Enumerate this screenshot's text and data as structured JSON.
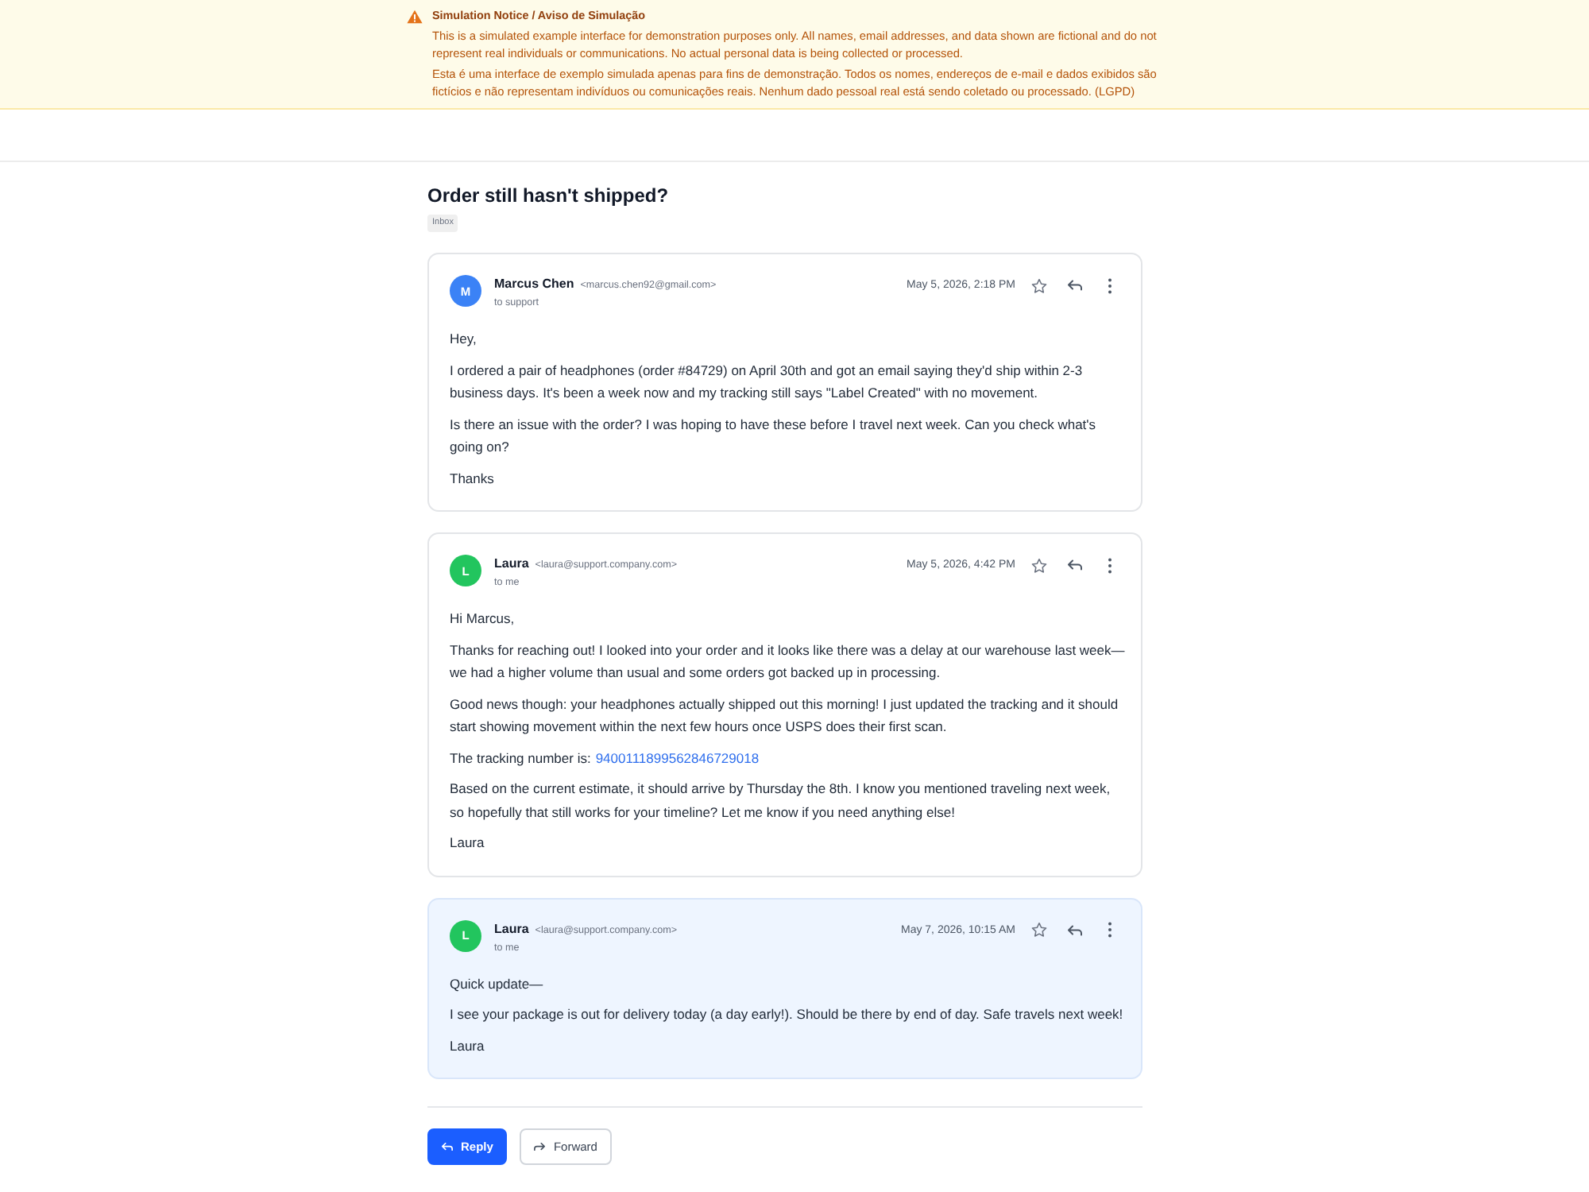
{
  "notice": {
    "title": "Simulation Notice / Aviso de Simulação",
    "paragraphs": [
      "This is a simulated example interface for demonstration purposes only. All names, email addresses, and data shown are fictional and do not represent real individuals or communications. No actual personal data is being collected or processed.",
      "Esta é uma interface de exemplo simulada apenas para fins de demonstração. Todos os nomes, endereços de e-mail e dados exibidos são fictícios e não representam indivíduos ou comunicações reais. Nenhum dado pessoal real está sendo coletado ou processado. (LGPD)"
    ]
  },
  "thread": {
    "subject": "Order still hasn't shipped?",
    "label": "Inbox"
  },
  "messages": [
    {
      "avatar": "M",
      "color": "#3b82f6",
      "sender": "Marcus Chen",
      "email": "<marcus.chen92@gmail.com>",
      "recipient": "to support",
      "date": "May 5, 2026, 2:18 PM",
      "starred": false,
      "highlighted": false,
      "paragraphs": [
        {
          "text": "Hey,"
        },
        {
          "text": "I ordered a pair of headphones (order #84729) on April 30th and got an email saying they'd ship within 2-3 business days. It's been a week now and my tracking still says \"Label Created\" with no movement."
        },
        {
          "text": "Is there an issue with the order? I was hoping to have these before I travel next week. Can you check what's going on?"
        },
        {
          "text": "Thanks"
        }
      ]
    },
    {
      "avatar": "L",
      "color": "#22c55e",
      "sender": "Laura",
      "email": "<laura@support.company.com>",
      "recipient": "to me",
      "date": "May 5, 2026, 4:42 PM",
      "starred": false,
      "highlighted": false,
      "paragraphs": [
        {
          "text": "Hi Marcus,"
        },
        {
          "text": "Thanks for reaching out! I looked into your order and it looks like there was a delay at our warehouse last week—we had a higher volume than usual and some orders got backed up in processing."
        },
        {
          "text": "Good news though: your headphones actually shipped out this morning! I just updated the tracking and it should start showing movement within the next few hours once USPS does their first scan."
        },
        {
          "text": "The tracking number is:",
          "link": "9400111899562846729018"
        },
        {
          "text": "Based on the current estimate, it should arrive by Thursday the 8th. I know you mentioned traveling next week, so hopefully that still works for your timeline? Let me know if you need anything else!"
        },
        {
          "text": "Laura"
        }
      ]
    },
    {
      "avatar": "L",
      "color": "#22c55e",
      "sender": "Laura",
      "email": "<laura@support.company.com>",
      "recipient": "to me",
      "date": "May 7, 2026, 10:15 AM",
      "starred": false,
      "highlighted": true,
      "paragraphs": [
        {
          "text": "Quick update—"
        },
        {
          "text": "I see your package is out for delivery today (a day early!). Should be there by end of day. Safe travels next week!"
        },
        {
          "text": "Laura"
        }
      ]
    }
  ],
  "actions": [
    {
      "kind": "reply",
      "label": "Reply"
    },
    {
      "kind": "forward",
      "label": "Forward"
    }
  ]
}
